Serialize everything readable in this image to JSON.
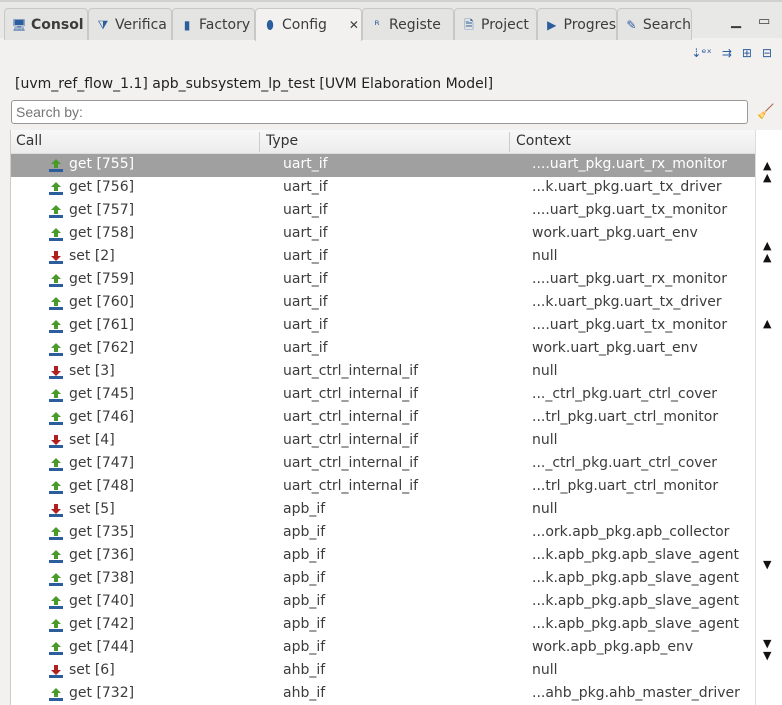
{
  "tabs": [
    {
      "label": "Consol",
      "icon": "console-icon",
      "bold": true
    },
    {
      "label": "Verifica",
      "icon": "verification-icon"
    },
    {
      "label": "Factory",
      "icon": "factory-icon"
    },
    {
      "label": "Config",
      "icon": "config-db-icon",
      "active": true
    },
    {
      "label": "Registe",
      "icon": "register-icon"
    },
    {
      "label": "Project",
      "icon": "project-icon"
    },
    {
      "label": "Progres",
      "icon": "progress-icon"
    },
    {
      "label": "Search",
      "icon": "search-icon"
    }
  ],
  "header": {
    "title": "[uvm_ref_flow_1.1] apb_subsystem_lp_test [UVM Elaboration Model]"
  },
  "search": {
    "placeholder": "Search by:"
  },
  "columns": [
    "Call",
    "Type",
    "Context"
  ],
  "rows": [
    {
      "call": "get [755]",
      "type": "uart_if",
      "context": "....uart_pkg.uart_rx_monitor",
      "kind": "get",
      "selected": true
    },
    {
      "call": "get [756]",
      "type": "uart_if",
      "context": "...k.uart_pkg.uart_tx_driver",
      "kind": "get"
    },
    {
      "call": "get [757]",
      "type": "uart_if",
      "context": "....uart_pkg.uart_tx_monitor",
      "kind": "get"
    },
    {
      "call": "get [758]",
      "type": "uart_if",
      "context": "work.uart_pkg.uart_env",
      "kind": "get"
    },
    {
      "call": "set [2]",
      "type": "uart_if",
      "context": "null",
      "kind": "set"
    },
    {
      "call": "get [759]",
      "type": "uart_if",
      "context": "....uart_pkg.uart_rx_monitor",
      "kind": "get"
    },
    {
      "call": "get [760]",
      "type": "uart_if",
      "context": "...k.uart_pkg.uart_tx_driver",
      "kind": "get"
    },
    {
      "call": "get [761]",
      "type": "uart_if",
      "context": "....uart_pkg.uart_tx_monitor",
      "kind": "get"
    },
    {
      "call": "get [762]",
      "type": "uart_if",
      "context": "work.uart_pkg.uart_env",
      "kind": "get"
    },
    {
      "call": "set [3]",
      "type": "uart_ctrl_internal_if",
      "context": "null",
      "kind": "set"
    },
    {
      "call": "get [745]",
      "type": "uart_ctrl_internal_if",
      "context": "..._ctrl_pkg.uart_ctrl_cover",
      "kind": "get"
    },
    {
      "call": "get [746]",
      "type": "uart_ctrl_internal_if",
      "context": "...trl_pkg.uart_ctrl_monitor",
      "kind": "get"
    },
    {
      "call": "set [4]",
      "type": "uart_ctrl_internal_if",
      "context": "null",
      "kind": "set"
    },
    {
      "call": "get [747]",
      "type": "uart_ctrl_internal_if",
      "context": "..._ctrl_pkg.uart_ctrl_cover",
      "kind": "get"
    },
    {
      "call": "get [748]",
      "type": "uart_ctrl_internal_if",
      "context": "...trl_pkg.uart_ctrl_monitor",
      "kind": "get"
    },
    {
      "call": "set [5]",
      "type": "apb_if",
      "context": "null",
      "kind": "set"
    },
    {
      "call": "get [735]",
      "type": "apb_if",
      "context": "...ork.apb_pkg.apb_collector",
      "kind": "get"
    },
    {
      "call": "get [736]",
      "type": "apb_if",
      "context": "...k.apb_pkg.apb_slave_agent",
      "kind": "get"
    },
    {
      "call": "get [738]",
      "type": "apb_if",
      "context": "...k.apb_pkg.apb_slave_agent",
      "kind": "get"
    },
    {
      "call": "get [740]",
      "type": "apb_if",
      "context": "...k.apb_pkg.apb_slave_agent",
      "kind": "get"
    },
    {
      "call": "get [742]",
      "type": "apb_if",
      "context": "...k.apb_pkg.apb_slave_agent",
      "kind": "get"
    },
    {
      "call": "get [744]",
      "type": "apb_if",
      "context": "work.apb_pkg.apb_env",
      "kind": "get"
    },
    {
      "call": "set [6]",
      "type": "ahb_if",
      "context": "null",
      "kind": "set"
    },
    {
      "call": "get [732]",
      "type": "ahb_if",
      "context": "...ahb_pkg.ahb_master_driver",
      "kind": "get"
    }
  ],
  "colors": {
    "get": "#4a9a2a",
    "set": "#b02020",
    "bar": "#2c5e9e",
    "selection": "#a0a0a0"
  }
}
